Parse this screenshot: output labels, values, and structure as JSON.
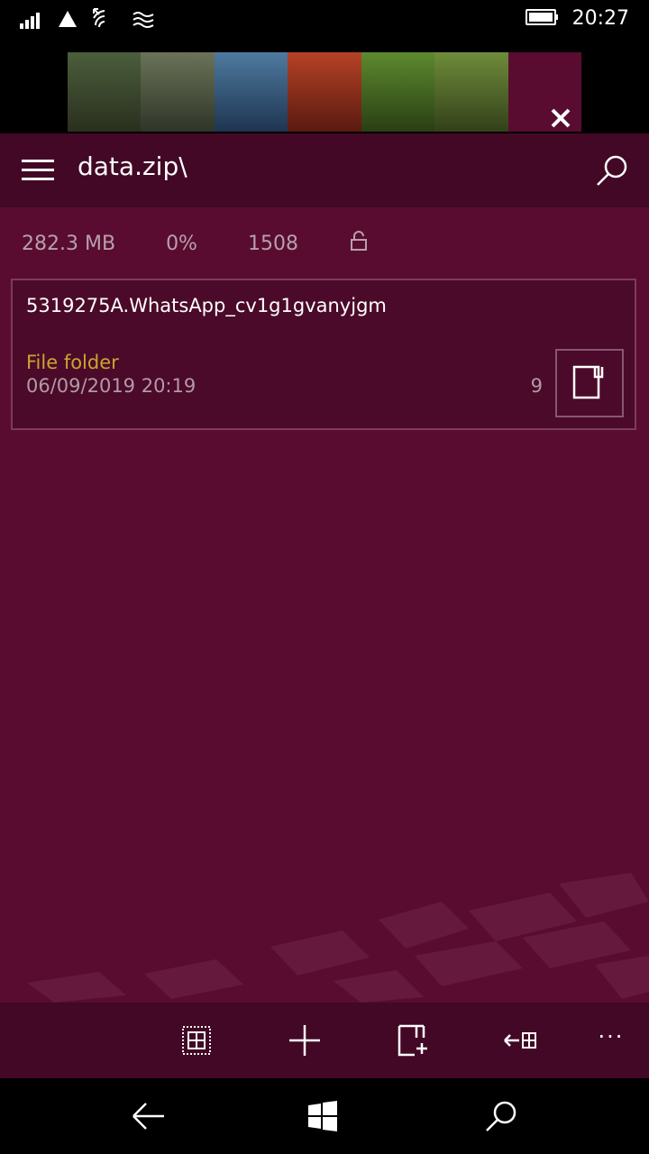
{
  "status_bar": {
    "time": "20:27",
    "icons": [
      "signal-icon",
      "data-icon",
      "wifi-icon",
      "vpn-icon",
      "battery-icon"
    ]
  },
  "ad": {
    "close_symbol": "✕",
    "colors": [
      "#3d4a2a",
      "#4c5a3a",
      "#3a5a78",
      "#8a2c1c",
      "#3e5a1e",
      "#4e6a2a"
    ]
  },
  "header": {
    "path": "data.zip\\",
    "menu_icon": "hamburger-icon",
    "search_icon": "search-icon"
  },
  "stats": {
    "size": "282.3 MB",
    "ratio": "0%",
    "count": "1508",
    "lock_icon": "lock-icon"
  },
  "items": [
    {
      "name": "5319275A.WhatsApp_cv1g1gvanyjgm",
      "type": "File folder",
      "date": "06/09/2019 20:19",
      "count": "9",
      "action_icon": "open-folder-icon"
    }
  ],
  "app_bar": {
    "buttons": [
      "select-all-icon",
      "add-icon",
      "new-file-icon",
      "extract-icon",
      "more-icon"
    ],
    "more_symbol": "···"
  },
  "nav_bar": {
    "buttons": [
      "back-icon",
      "windows-icon",
      "search-icon"
    ]
  },
  "theme": {
    "accent": "#5a0c30",
    "header": "#420825",
    "folder_type_color": "#c9a531"
  }
}
